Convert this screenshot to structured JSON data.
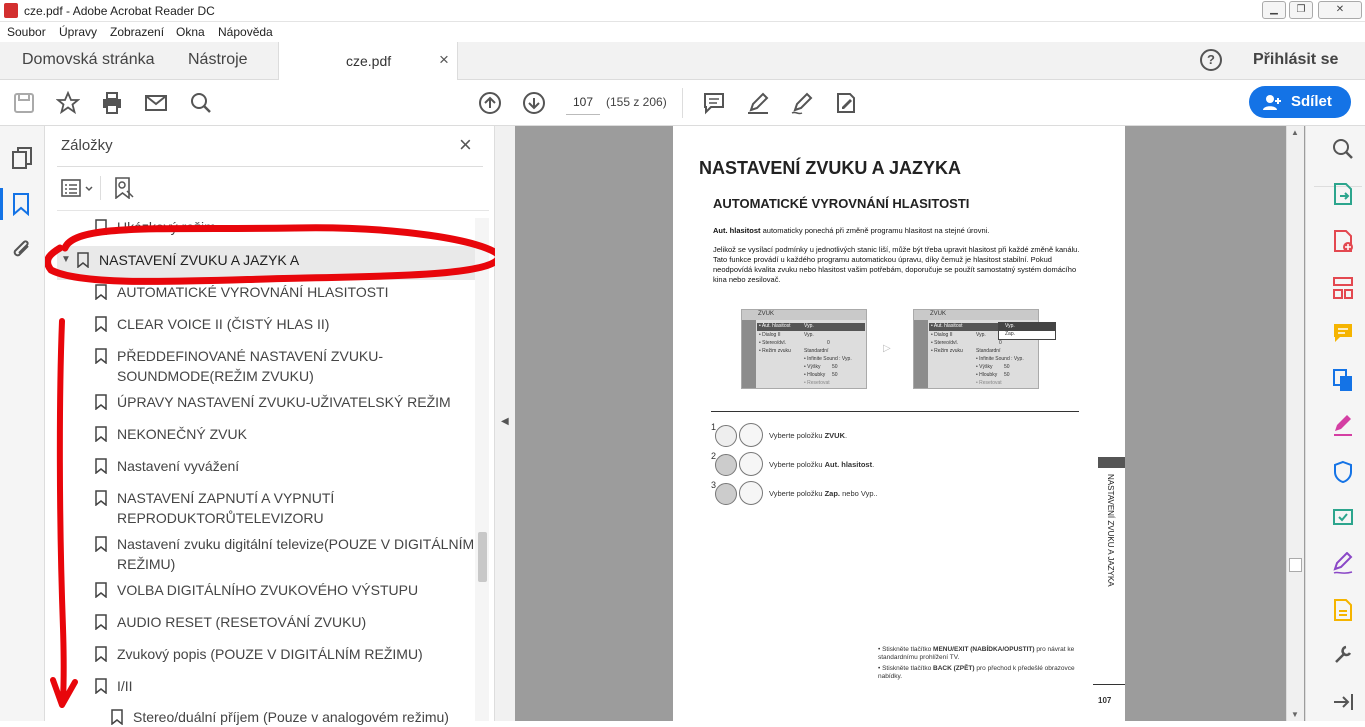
{
  "window": {
    "title": "cze.pdf - Adobe Acrobat Reader DC"
  },
  "menu": [
    "Soubor",
    "Úpravy",
    "Zobrazení",
    "Okna",
    "Nápověda"
  ],
  "tabs": {
    "home": "Domovská stránka",
    "tools": "Nástroje",
    "file": "cze.pdf",
    "close": "×"
  },
  "header": {
    "help": "?",
    "signin": "Přihlásit se"
  },
  "toolbar": {
    "page_value": "107",
    "page_info": "(155 z 206)",
    "share": "Sdílet"
  },
  "bookmarks": {
    "title": "Záložky",
    "close": "×",
    "items": [
      "Ukázkový režim",
      "NASTAVENÍ ZVUKU A JAZYK A",
      "AUTOMATICKÉ VYROVNÁNÍ HLASITOSTI",
      "CLEAR VOICE II (ČISTÝ HLAS II)",
      "PŘEDDEFINOVANÉ NASTAVENÍ ZVUKU-SOUNDMODE(REŽIM ZVUKU)",
      "ÚPRAVY NASTAVENÍ ZVUKU-UŽIVATELSKÝ REŽIM",
      "NEKONEČNÝ ZVUK",
      "Nastavení vyvážení",
      "NASTAVENÍ ZAPNUTÍ A VYPNUTÍ REPRODUKTORŮTELEVIZORU",
      "Nastavení zvuku digitální televize(POUZE V DIGITÁLNÍM REŽIMU)",
      "VOLBA DIGITÁLNÍHO ZVUKOVÉHO VÝSTUPU",
      "AUDIO RESET (RESETOVÁNÍ ZVUKU)",
      "Zvukový popis (POUZE V DIGITÁLNÍM REŽIMU)",
      "I/II",
      "Stereo/duální příjem (Pouze v analogovém režimu)"
    ]
  },
  "page": {
    "heading": "NASTAVENÍ ZVUKU A  JAZYKA",
    "subheading": "AUTOMATICKÉ VYROVNÁNÍ HLASITOSTI",
    "para1_bold": "Aut. hlasitost",
    "para1": " automaticky ponechá při změně programu hlasitost na stejné úrovni.",
    "para2": "Jelikož se vysílací podmínky u jednotlivých stanic liší, může být třeba upravit hlasitost při každé změně kanálu. Tato funkce provádí u každého programu automatickou úpravu, díky čemuž je hlasitost stabilní. Pokud neodpovídá kvalita zvuku nebo hlasitost vašim potřebám, doporučuje se použít samostatný systém domácího kina nebo zesilovač.",
    "screen_title": "ZVUK",
    "screen_items": [
      "• Aut. hlasitost",
      "• Dialog II",
      "• Stereo/dvl.",
      "• Režim zvuku"
    ],
    "screen_values": [
      "Vyp.",
      "Vyp.",
      "0",
      "Standardní",
      "• Infinite Sound : Vyp.",
      "• Výšky",
      "• Hloubky",
      "• Resetovat"
    ],
    "screen_num": "50",
    "popup": [
      "Vyp.",
      "Zap."
    ],
    "steps": [
      {
        "num": "1",
        "text_pre": "Vyberte položku ",
        "text_bold": "ZVUK",
        "text_post": "."
      },
      {
        "num": "2",
        "text_pre": "Vyberte položku ",
        "text_bold": "Aut. hlasitost",
        "text_post": "."
      },
      {
        "num": "3",
        "text_pre": "Vyberte položku ",
        "text_bold": "Zap.",
        "text_post": " nebo Vyp.."
      }
    ],
    "side_label": "NASTAVENÍ ZVUKU A  JAZYKA",
    "note1_pre": "Stiskněte tlačítko ",
    "note1_bold": "MENU/EXIT (NABÍDKA/OPUSTIT)",
    "note1_post": " pro návrat ke standardnímu prohlížení TV.",
    "note2_pre": "Stiskněte tlačítko ",
    "note2_bold": "BACK (ZPĚT)",
    "note2_post": " pro přechod k předešlé obrazovce nabídky.",
    "page_number": "107"
  },
  "colors": {
    "accent": "#1473e6",
    "annotation": "#e8060b",
    "viewer_bg": "#9c9c9c"
  }
}
